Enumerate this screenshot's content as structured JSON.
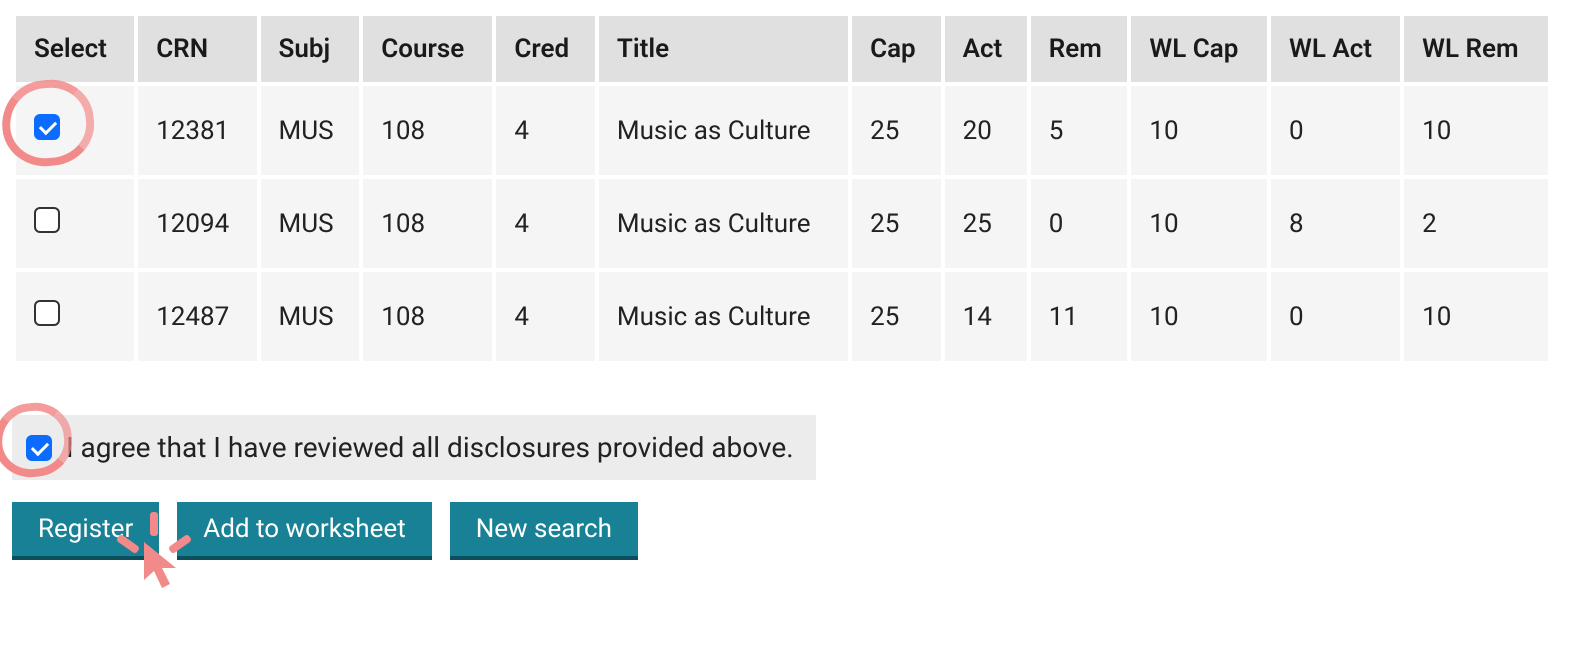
{
  "table": {
    "headers": [
      "Select",
      "CRN",
      "Subj",
      "Course",
      "Cred",
      "Title",
      "Cap",
      "Act",
      "Rem",
      "WL Cap",
      "WL Act",
      "WL Rem"
    ],
    "rows": [
      {
        "selected": true,
        "crn": "12381",
        "subj": "MUS",
        "course": "108",
        "cred": "4",
        "title": "Music as Culture",
        "cap": "25",
        "act": "20",
        "rem": "5",
        "wlcap": "10",
        "wlact": "0",
        "wlrem": "10"
      },
      {
        "selected": false,
        "crn": "12094",
        "subj": "MUS",
        "course": "108",
        "cred": "4",
        "title": "Music as Culture",
        "cap": "25",
        "act": "25",
        "rem": "0",
        "wlcap": "10",
        "wlact": "8",
        "wlrem": "2"
      },
      {
        "selected": false,
        "crn": "12487",
        "subj": "MUS",
        "course": "108",
        "cred": "4",
        "title": "Music as Culture",
        "cap": "25",
        "act": "14",
        "rem": "11",
        "wlcap": "10",
        "wlact": "0",
        "wlrem": "10"
      }
    ]
  },
  "agree": {
    "checked": true,
    "text": "I agree that I have reviewed all disclosures provided above."
  },
  "buttons": {
    "register": "Register",
    "add_worksheet": "Add to worksheet",
    "new_search": "New search"
  },
  "annotations": {
    "circle_row0": true,
    "circle_agree": true,
    "click_register": true
  }
}
